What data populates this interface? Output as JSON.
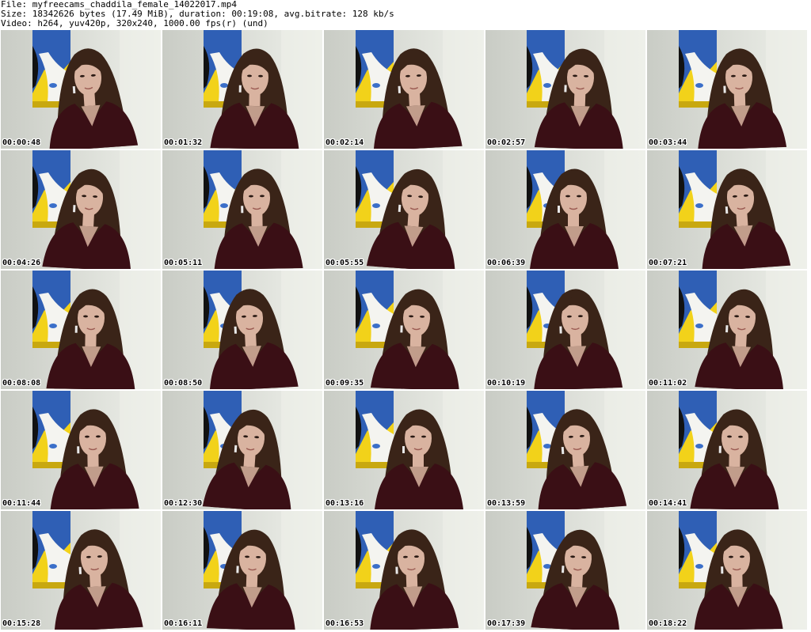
{
  "header": {
    "file_line": "File: myfreecams_chaddila_female_14022017.mp4",
    "size_line": "Size: 18342626 bytes (17.49 MiB), duration: 00:19:08, avg.bitrate: 128 kb/s",
    "video_line": "Video: h264, yuv420p, 320x240, 1000.00 fps(r) (und)"
  },
  "colors": {
    "wall": "#dfe2dc",
    "poster_yellow": "#f2d21a",
    "poster_blue": "#2f5fb5",
    "poster_white": "#f4f4f0",
    "hair": "#3a2418",
    "skin": "#d9b3a0",
    "top": "#3a0f15"
  },
  "thumbnails": [
    {
      "timestamp": "00:00:48",
      "image": "webcam-frame"
    },
    {
      "timestamp": "00:01:32",
      "image": "webcam-frame"
    },
    {
      "timestamp": "00:02:14",
      "image": "webcam-frame"
    },
    {
      "timestamp": "00:02:57",
      "image": "webcam-frame"
    },
    {
      "timestamp": "00:03:44",
      "image": "webcam-frame"
    },
    {
      "timestamp": "00:04:26",
      "image": "webcam-frame"
    },
    {
      "timestamp": "00:05:11",
      "image": "webcam-frame"
    },
    {
      "timestamp": "00:05:55",
      "image": "webcam-frame"
    },
    {
      "timestamp": "00:06:39",
      "image": "webcam-frame"
    },
    {
      "timestamp": "00:07:21",
      "image": "webcam-frame"
    },
    {
      "timestamp": "00:08:08",
      "image": "webcam-frame"
    },
    {
      "timestamp": "00:08:50",
      "image": "webcam-frame"
    },
    {
      "timestamp": "00:09:35",
      "image": "webcam-frame"
    },
    {
      "timestamp": "00:10:19",
      "image": "webcam-frame"
    },
    {
      "timestamp": "00:11:02",
      "image": "webcam-frame"
    },
    {
      "timestamp": "00:11:44",
      "image": "webcam-frame"
    },
    {
      "timestamp": "00:12:30",
      "image": "webcam-frame"
    },
    {
      "timestamp": "00:13:16",
      "image": "webcam-frame"
    },
    {
      "timestamp": "00:13:59",
      "image": "webcam-frame"
    },
    {
      "timestamp": "00:14:41",
      "image": "webcam-frame"
    },
    {
      "timestamp": "00:15:28",
      "image": "webcam-frame"
    },
    {
      "timestamp": "00:16:11",
      "image": "webcam-frame"
    },
    {
      "timestamp": "00:16:53",
      "image": "webcam-frame"
    },
    {
      "timestamp": "00:17:39",
      "image": "webcam-frame"
    },
    {
      "timestamp": "00:18:22",
      "image": "webcam-frame"
    }
  ]
}
